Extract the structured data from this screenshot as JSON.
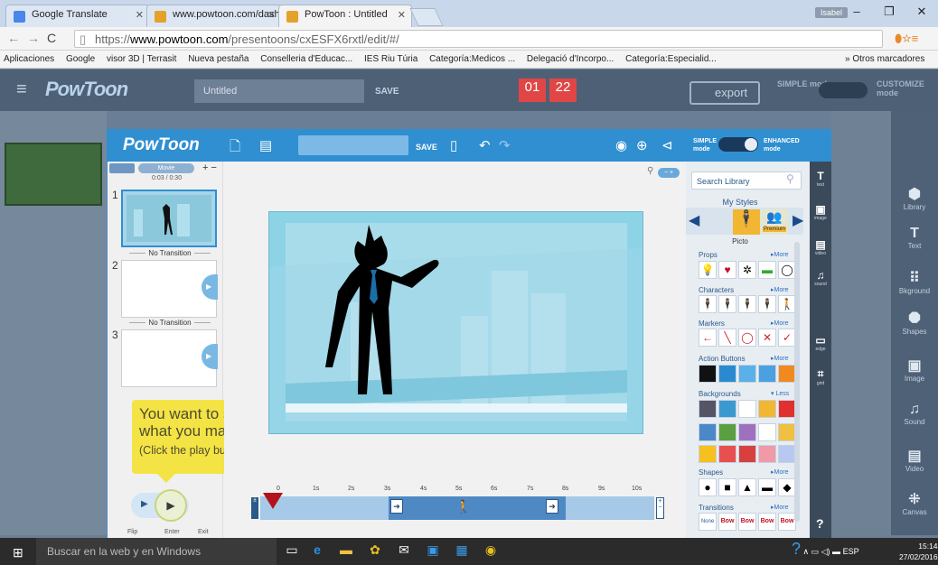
{
  "browser": {
    "tabs": [
      {
        "label": "Google Translate"
      },
      {
        "label": "www.powtoon.com/dashb"
      },
      {
        "label": "PowToon : Untitled"
      }
    ],
    "user_badge": "Isabel",
    "url_prefix": "https://",
    "url_domain": "www.powtoon.com",
    "url_path": "/presentoons/cxESFX6rxtl/edit/#/",
    "bookmarks": [
      "Aplicaciones",
      "Google",
      "visor 3D | Terrasit",
      "Nueva pestaña",
      "Conselleria d'Educac...",
      "IES Riu Túria",
      "Categoría:Medicos ...",
      "Delegació d'Incorpo...",
      "Categoría:Especialid..."
    ],
    "other_bookmarks": "Otros marcadores"
  },
  "bg_editor": {
    "logo": "PowToon",
    "title": "Untitled",
    "save": "SAVE",
    "count_days": "01",
    "count_hours": "22",
    "export": "export",
    "mode_simple": "SIMPLE mode",
    "mode_customize": "CUSTOMIZE mode",
    "tools": [
      "Library",
      "Text",
      "Bkground",
      "Shapes",
      "Image",
      "Sound",
      "Video",
      "Canvas"
    ]
  },
  "editor": {
    "logo": "PowToon",
    "save": "SAVE",
    "mode_simple": "SIMPLE\nmode",
    "mode_enhanced": "ENHANCED\nmode",
    "movie_label": "Movie",
    "movie_time": "0:03 / 0:30",
    "slides": [
      "1",
      "2",
      "3"
    ],
    "transition": "No Transition",
    "callout_line1": "You want to see",
    "callout_line2": "what you made?",
    "callout_hint": "(Click the play button)",
    "play_labels": [
      "Flip",
      "Enter",
      "Exit"
    ],
    "timeline_ticks": [
      "0",
      "1s",
      "2s",
      "3s",
      "4s",
      "5s",
      "6s",
      "7s",
      "8s",
      "9s",
      "10s"
    ]
  },
  "library": {
    "search_placeholder": "Search Library",
    "my_styles": "My Styles",
    "style_name": "Picto",
    "premium": "Premium",
    "sections": [
      {
        "name": "Props",
        "more": "▸More"
      },
      {
        "name": "Characters",
        "more": "▸More"
      },
      {
        "name": "Markers",
        "more": "▸More"
      },
      {
        "name": "Action Buttons",
        "more": "▸More"
      },
      {
        "name": "Backgrounds",
        "more": "▾ Less"
      },
      {
        "name": "Shapes",
        "more": "▸More"
      },
      {
        "name": "Transitions",
        "more": "▸More"
      }
    ],
    "transition_items": [
      "None",
      "Bow",
      "Bow",
      "Bow",
      "Bow"
    ],
    "sidebar": [
      "text",
      "image",
      "video",
      "sound",
      "edge",
      "grid"
    ]
  },
  "taskbar": {
    "search": "Buscar en la web y en Windows",
    "lang": "ESP",
    "time": "15:14",
    "date": "27/02/2016"
  }
}
